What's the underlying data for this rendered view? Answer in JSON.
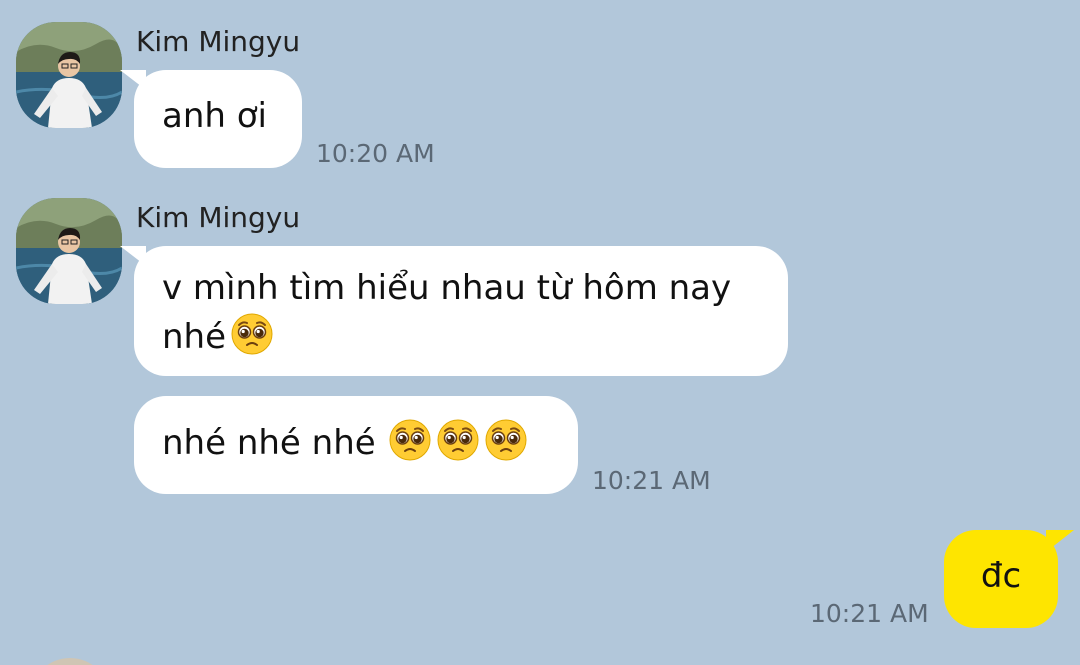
{
  "chat": {
    "messages": [
      {
        "sender": "Kim Mingyu",
        "text": "anh ơi",
        "time": "10:20 AM"
      },
      {
        "sender": "Kim Mingyu",
        "text_line1": "v mình tìm hiểu nhau từ hôm nay",
        "text_line2": "nhé",
        "emoji": "pleading-face-emoji"
      },
      {
        "text": "nhé nhé nhé",
        "emojis": [
          "pleading-face-emoji",
          "pleading-face-emoji",
          "pleading-face-emoji"
        ],
        "time": "10:21 AM"
      },
      {
        "from_me": true,
        "text": "đc",
        "time": "10:21 AM"
      }
    ]
  },
  "colors": {
    "background": "#b2c7da",
    "incoming_bubble": "#ffffff",
    "outgoing_bubble": "#fee500",
    "timestamp": "#5b6875"
  }
}
